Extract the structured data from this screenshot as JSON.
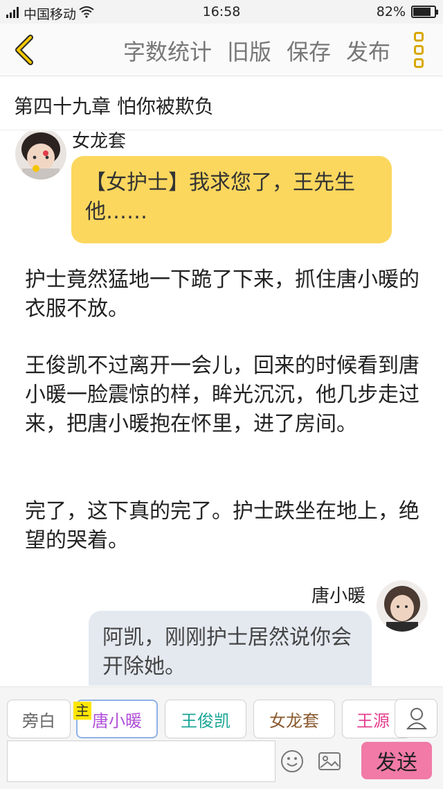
{
  "status": {
    "carrier": "中国移动",
    "network": "4G",
    "time": "16:58",
    "battery": "82%",
    "battery_level": 0.82
  },
  "toolbar": {
    "actions": [
      "字数统计",
      "旧版",
      "保存",
      "发布"
    ]
  },
  "chapter": {
    "title": "第四十九章 怕你被欺负"
  },
  "messages": [
    {
      "speaker": "女龙套",
      "text": "【女护士】我求您了，王先生他……"
    },
    {
      "speaker": "唐小暖",
      "text": "阿凯，刚刚护士居然说你会开除她。"
    }
  ],
  "narration": [
    "护士竟然猛地一下跪了下来，抓住唐小暖的衣服不放。",
    "王俊凯不过离开一会儿，回来的时候看到唐小暖一脸震惊的样，眸光沉沉，他几步走过来，把唐小暖抱在怀里，进了房间。",
    "完了，这下真的完了。护士跌坐在地上，绝望的哭着。"
  ],
  "characters": [
    {
      "name": "旁白",
      "color": "#666666"
    },
    {
      "name": "唐小暖",
      "color": "#b04fd8"
    },
    {
      "name": "王俊凯",
      "color": "#1aa596"
    },
    {
      "name": "女龙套",
      "color": "#8a5a2e"
    },
    {
      "name": "王源",
      "color": "#e43f8f"
    }
  ],
  "main_badge": "主",
  "send_label": "发送"
}
